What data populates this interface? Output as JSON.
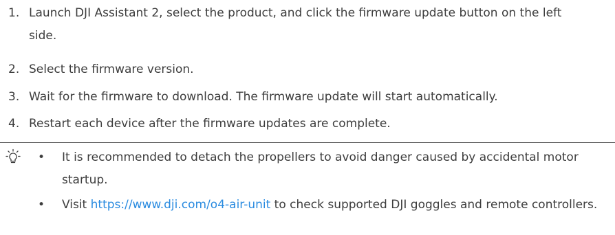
{
  "steps": [
    {
      "number": "1.",
      "text": "Launch DJI Assistant 2, select the product, and click the firmware update button on the left side."
    },
    {
      "number": "2.",
      "text": "Select the firmware version."
    },
    {
      "number": "3.",
      "text": "Wait for the firmware to download. The firmware update will start automatically."
    },
    {
      "number": "4.",
      "text": "Restart each device after the firmware updates are complete."
    }
  ],
  "tips": {
    "icon": "lightbulb-icon",
    "items": [
      {
        "bullet": "•",
        "text": "It is recommended to detach the propellers to avoid danger caused by accidental motor startup."
      },
      {
        "bullet": "•",
        "text_before": "Visit ",
        "link": "https://www.dji.com/o4-air-unit",
        "text_after": " to check supported DJI goggles and remote controllers."
      }
    ]
  },
  "colors": {
    "text": "#3d3d3d",
    "link": "#2a8be0",
    "rule": "#5a5a5a"
  }
}
